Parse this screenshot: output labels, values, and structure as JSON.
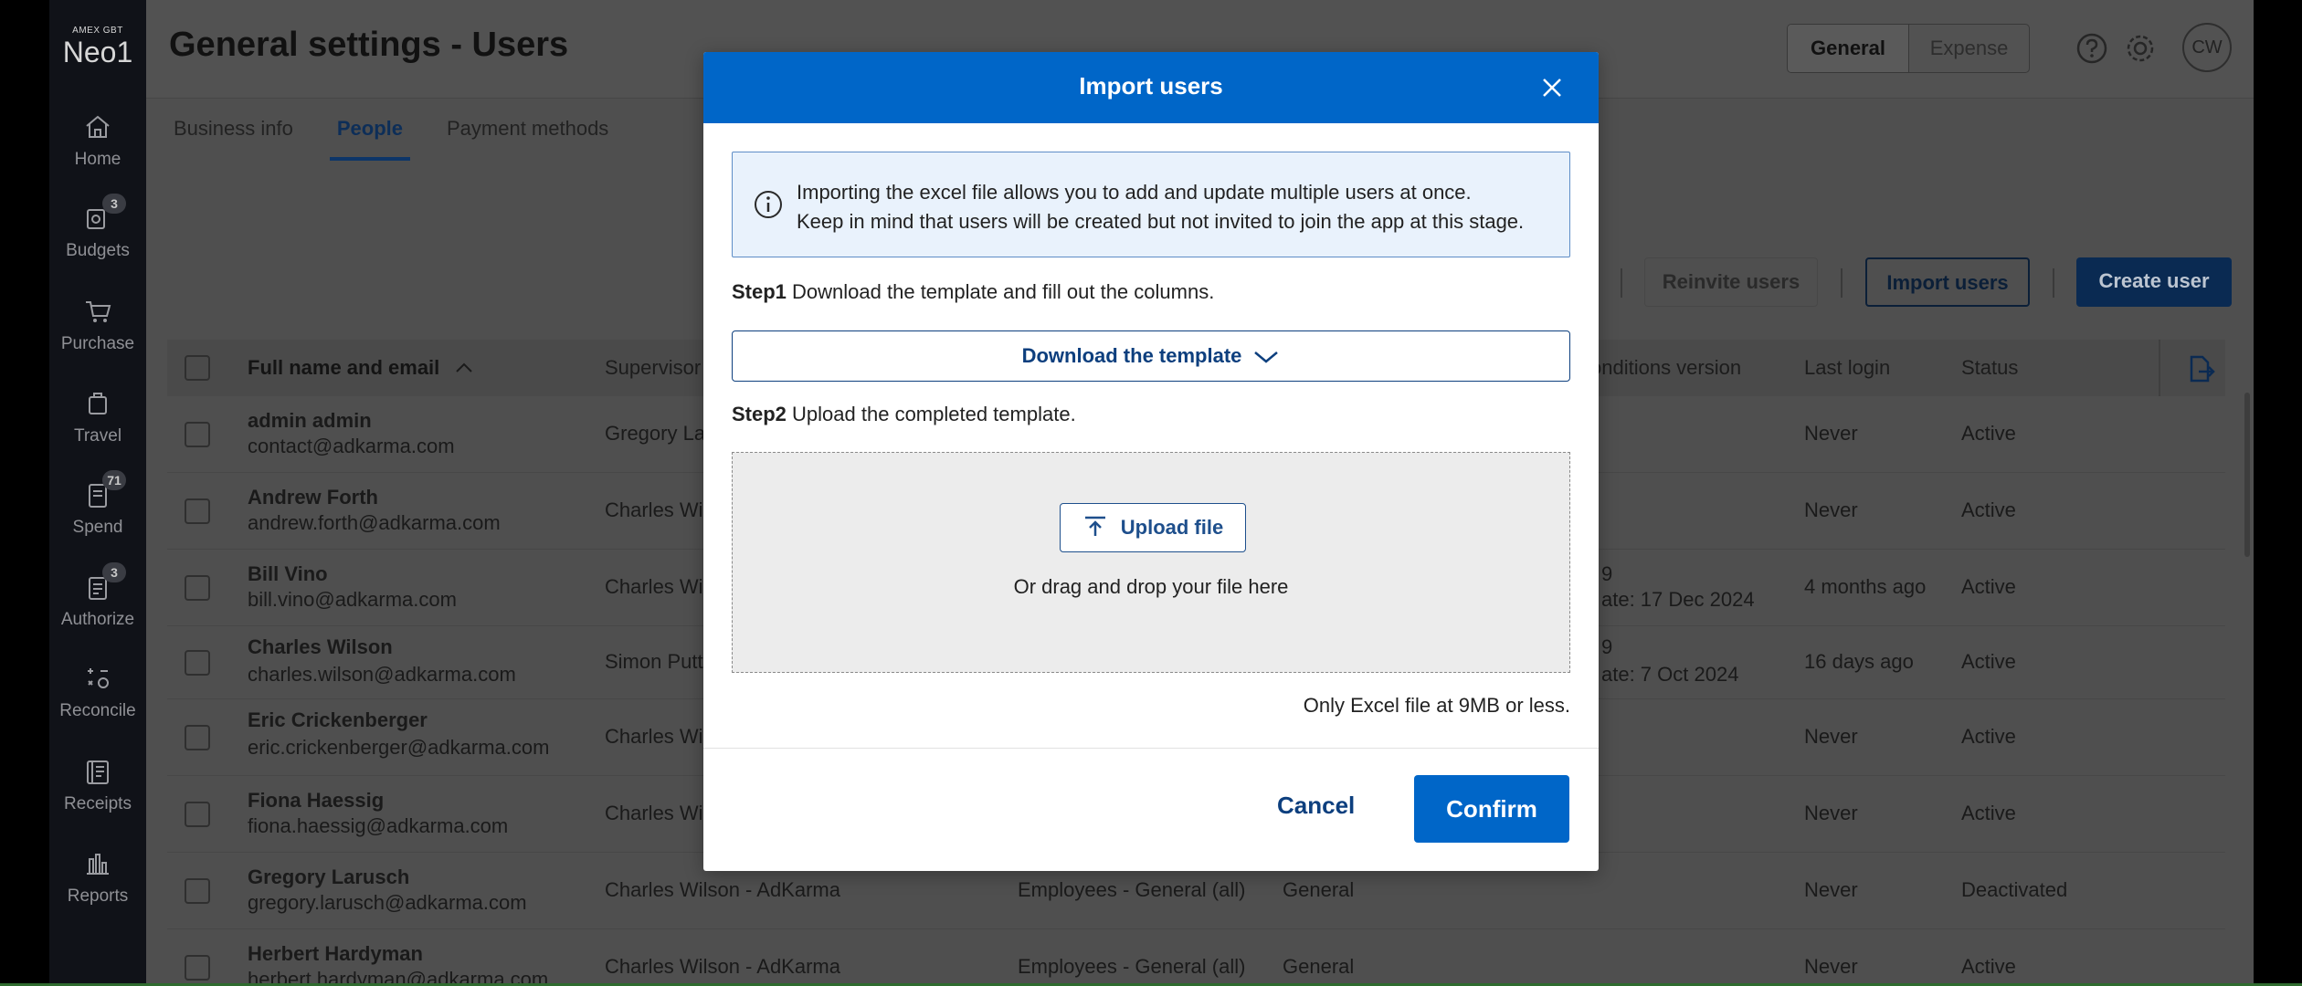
{
  "brand": {
    "small": "AMEX GBT",
    "big": "Neo1"
  },
  "nav": [
    {
      "label": "Home",
      "icon": "home-icon",
      "badge": ""
    },
    {
      "label": "Budgets",
      "icon": "budgets-icon",
      "badge": "3"
    },
    {
      "label": "Purchase",
      "icon": "cart-icon",
      "badge": ""
    },
    {
      "label": "Travel",
      "icon": "suitcase-icon",
      "badge": ""
    },
    {
      "label": "Spend",
      "icon": "receipt-icon",
      "badge": "71"
    },
    {
      "label": "Authorize",
      "icon": "clipboard-icon",
      "badge": "3"
    },
    {
      "label": "Reconcile",
      "icon": "calculator-icon",
      "badge": ""
    },
    {
      "label": "Receipts",
      "icon": "receipts-icon",
      "badge": ""
    },
    {
      "label": "Reports",
      "icon": "bar-chart-icon",
      "badge": ""
    }
  ],
  "header": {
    "title": "General settings - Users",
    "segment": {
      "general": "General",
      "expense": "Expense"
    },
    "avatar": "CW"
  },
  "tabs": [
    {
      "label": "Business info"
    },
    {
      "label": "People"
    },
    {
      "label": "Payment methods"
    }
  ],
  "actions": {
    "reinvite": "Reinvite users",
    "import": "Import users",
    "create": "Create user"
  },
  "table": {
    "headers": {
      "name": "Full name and email",
      "supervisor": "Supervisor",
      "terms": "onditions version",
      "last_login": "Last login",
      "status": "Status"
    },
    "rows": [
      {
        "name": "admin admin",
        "email": "contact@adkarma.com",
        "supervisor": "Gregory La",
        "group": "",
        "policy": "",
        "terms1": "",
        "terms2": "",
        "last_login": "Never",
        "status": "Active"
      },
      {
        "name": "Andrew Forth",
        "email": "andrew.forth@adkarma.com",
        "supervisor": "Charles Wil",
        "group": "",
        "policy": "",
        "terms1": "",
        "terms2": "",
        "last_login": "Never",
        "status": "Active"
      },
      {
        "name": "Bill Vino",
        "email": "bill.vino@adkarma.com",
        "supervisor": "Charles Wil",
        "group": "",
        "policy": "",
        "terms1": "9",
        "terms2": "ate: 17 Dec 2024",
        "last_login": "4 months ago",
        "status": "Active"
      },
      {
        "name": "Charles Wilson",
        "email": "charles.wilson@adkarma.com",
        "supervisor": "Simon Putt",
        "group": "",
        "policy": "",
        "terms1": "9",
        "terms2": "ate: 7 Oct 2024",
        "last_login": "16 days ago",
        "status": "Active"
      },
      {
        "name": "Eric Crickenberger",
        "email": "eric.crickenberger@adkarma.com",
        "supervisor": "Charles Wil",
        "group": "",
        "policy": "",
        "terms1": "",
        "terms2": "",
        "last_login": "Never",
        "status": "Active"
      },
      {
        "name": "Fiona Haessig",
        "email": "fiona.haessig@adkarma.com",
        "supervisor": "Charles Wil",
        "group": "",
        "policy": "",
        "terms1": "",
        "terms2": "",
        "last_login": "Never",
        "status": "Active"
      },
      {
        "name": "Gregory Larusch",
        "email": "gregory.larusch@adkarma.com",
        "supervisor": "Charles Wilson - AdKarma",
        "group": "Employees - General (all)",
        "policy": "General",
        "terms1": "",
        "terms2": "",
        "last_login": "Never",
        "status": "Deactivated"
      },
      {
        "name": "Herbert Hardyman",
        "email": "herbert.hardyman@adkarma.com",
        "supervisor": "Charles Wilson - AdKarma",
        "group": "Employees - General (all)",
        "policy": "General",
        "terms1": "",
        "terms2": "",
        "last_login": "Never",
        "status": "Active"
      }
    ]
  },
  "modal": {
    "title": "Import users",
    "info_line1": "Importing the excel file allows you to add and update multiple users at once.",
    "info_line2": "Keep in mind that users will be created but not invited to join the app at this stage.",
    "step1_label": "Step1",
    "step1_text": "Download the template and fill out the columns.",
    "download_label": "Download the template",
    "step2_label": "Step2",
    "step2_text": "Upload the completed template.",
    "upload_label": "Upload file",
    "drop_text": "Or drag and drop your file here",
    "limit_text": "Only Excel file at 9MB or less.",
    "cancel_label": "Cancel",
    "confirm_label": "Confirm"
  }
}
